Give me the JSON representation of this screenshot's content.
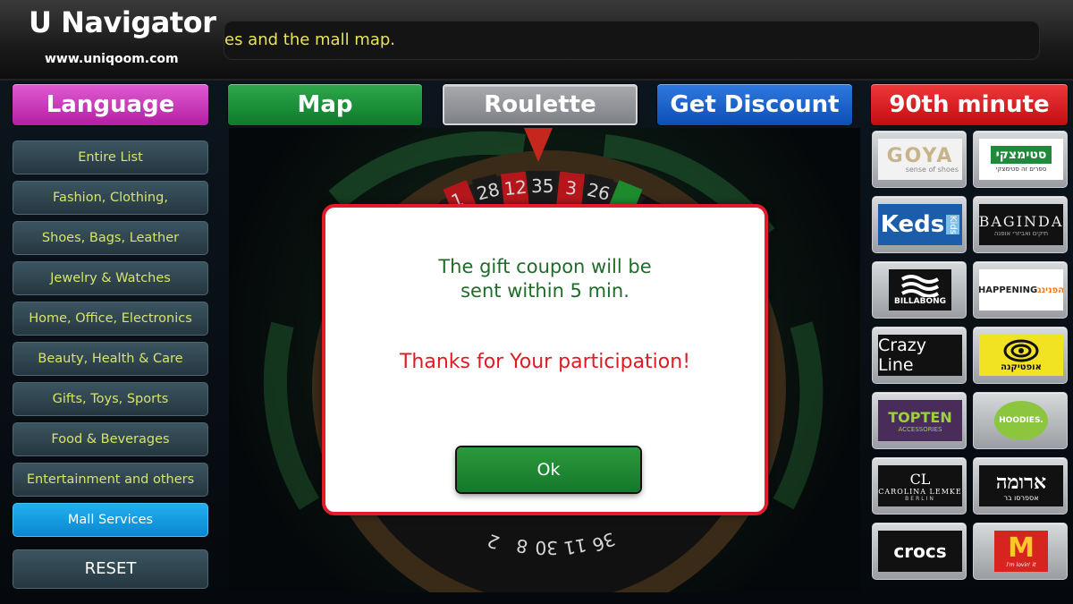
{
  "header": {
    "title": "U Navigator",
    "url": "www.uniqoom.com",
    "ticker_text": "es and the mall map."
  },
  "nav": {
    "language": "Language",
    "map": "Map",
    "roulette": "Roulette",
    "get_discount": "Get Discount",
    "ninetieth_minute": "90th minute"
  },
  "sidebar": {
    "items": [
      {
        "label": "Entire List"
      },
      {
        "label": "Fashion, Clothing, Accessories"
      },
      {
        "label": "Shoes, Bags, Leather"
      },
      {
        "label": "Jewelry & Watches"
      },
      {
        "label": "Home, Office, Electronics"
      },
      {
        "label": "Beauty, Health & Care"
      },
      {
        "label": "Gifts, Toys, Sports"
      },
      {
        "label": "Food & Beverages"
      },
      {
        "label": "Entertainment and others"
      },
      {
        "label": "Mall Services"
      }
    ],
    "active_index": 9,
    "reset_label": "RESET"
  },
  "roulette": {
    "visible_numbers_top": [
      "1",
      "28",
      "12",
      "35",
      "3",
      "26"
    ],
    "visible_numbers_bottom": [
      "2",
      "8",
      "30",
      "11",
      "36"
    ]
  },
  "brands": {
    "goya": {
      "name": "GOYA",
      "tagline": "sense of shoes"
    },
    "stimatzky": {
      "name": "סטימצקי",
      "tagline": "ספרים זה סטימצקי"
    },
    "keds": {
      "name": "Keds",
      "sub": "Kids"
    },
    "bagind": {
      "name": "BAGINDA",
      "tagline": "תיקים ואביזרי אופנה"
    },
    "billabong": {
      "name": "BILLABONG"
    },
    "happening": {
      "name": "HAPPENING",
      "sub": "הפנינג"
    },
    "crazyline": {
      "name": "Crazy Line"
    },
    "opticana": {
      "name": "אופטיקנה"
    },
    "topten": {
      "name": "TOPTEN",
      "sub": "ACCESSORIES"
    },
    "hoodies": {
      "name": "HOODIES."
    },
    "carolina": {
      "mono": "CL",
      "name": "CAROLINA LEMKE",
      "city": "BERLIN"
    },
    "aroma": {
      "name": "ארומה",
      "sub": "אספרסו בר"
    },
    "crocs": {
      "name": "crocs"
    },
    "mcdonalds": {
      "mark": "M",
      "slogan": "i'm lovin' it"
    }
  },
  "modal": {
    "line1": "The gift coupon will be",
    "line2": "sent within 5 min.",
    "thanks": "Thanks for Your participation!",
    "ok_label": "Ok"
  },
  "colors": {
    "accent_red": "#e21c2a",
    "modal_green_text": "#1f6b2a",
    "sidebar_text": "#d7e36d",
    "active_blue": "#0a86d0"
  }
}
